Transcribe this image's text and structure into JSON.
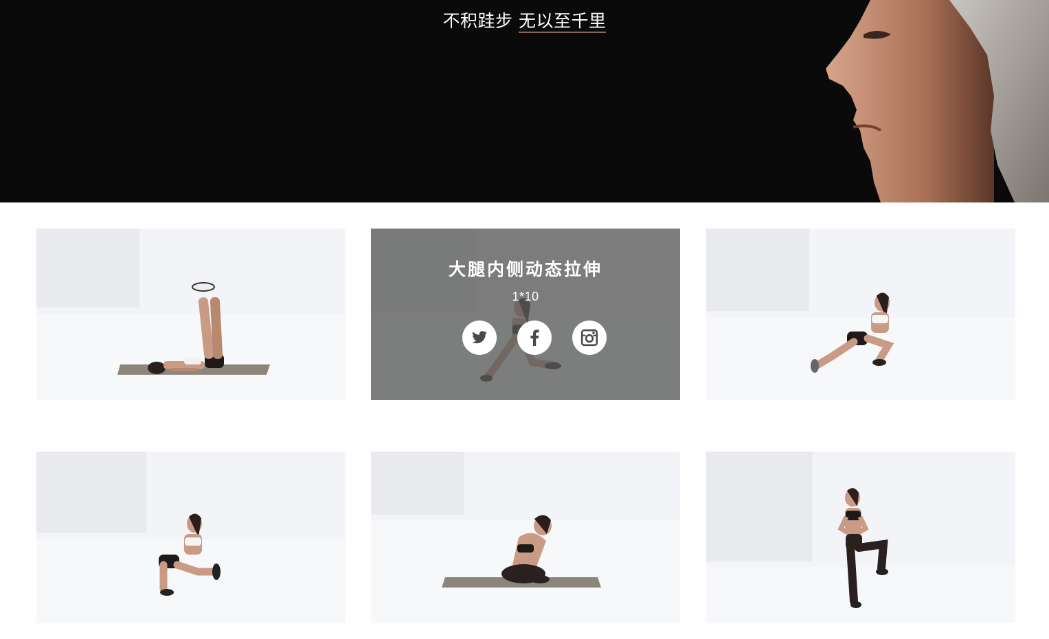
{
  "hero": {
    "title_plain": "不积跬步",
    "title_underlined": "无以至千里"
  },
  "cards": [
    {
      "pose": "lying-leg-raise"
    },
    {
      "pose": "inner-thigh-lunge",
      "overlay": {
        "title": "大腿内侧动态拉伸",
        "sets": "1*10",
        "social": [
          "twitter-icon",
          "facebook-icon",
          "instagram-icon"
        ]
      }
    },
    {
      "pose": "side-lunge-stretch"
    },
    {
      "pose": "squat-leg-extend"
    },
    {
      "pose": "seated-butterfly"
    },
    {
      "pose": "standing-knee-raise"
    }
  ],
  "colors": {
    "hero_bg": "#0a0a0a",
    "card_bg": "#f3f4f8",
    "overlay": "#5a5a5a",
    "mat": "#8c857a",
    "skin": "#c99a84",
    "outfit": "#1e1a1a"
  }
}
